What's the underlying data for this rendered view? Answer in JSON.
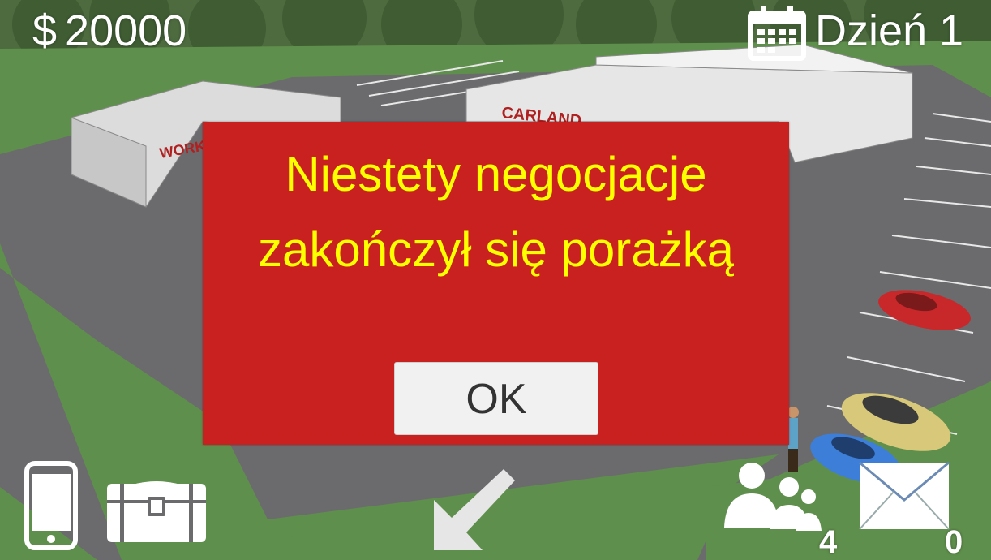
{
  "hud": {
    "currency_symbol": "$",
    "money": "20000",
    "day_label": "Dzień 1"
  },
  "scene": {
    "building_signs": [
      "WORK",
      "CARLAND"
    ]
  },
  "dialog": {
    "message": "Niestety negocjacje zakończył się porażką",
    "ok_label": "OK",
    "background_color": "#c8211f",
    "text_color": "#ffff00"
  },
  "toolbar": {
    "contacts_count": "4",
    "messages_count": "0"
  },
  "icons": [
    "dollar-icon",
    "calendar-icon",
    "phone-icon",
    "chest-icon",
    "arrow-down-left-icon",
    "people-icon",
    "mail-icon"
  ]
}
